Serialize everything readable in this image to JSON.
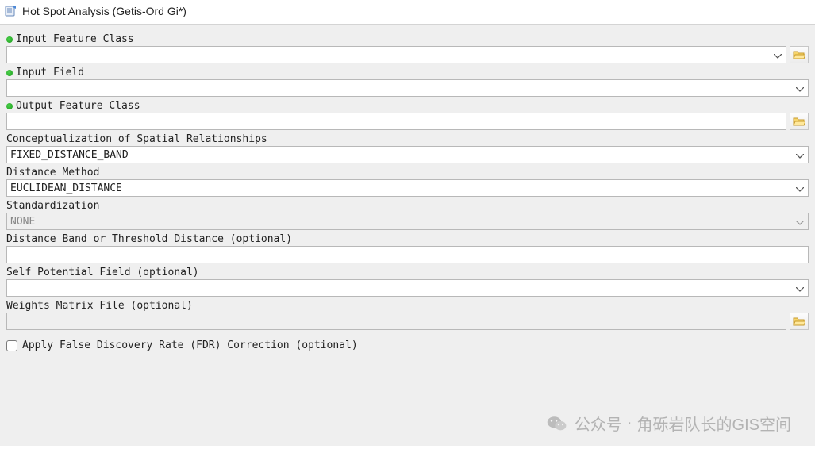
{
  "window": {
    "title": "Hot Spot Analysis (Getis-Ord Gi*)"
  },
  "params": {
    "input_feature_class": {
      "label": "Input Feature Class",
      "value": "",
      "required": true
    },
    "input_field": {
      "label": "Input Field",
      "value": "",
      "required": true
    },
    "output_feature_class": {
      "label": "Output Feature Class",
      "value": "",
      "required": true
    },
    "conceptualization": {
      "label": "Conceptualization of Spatial Relationships",
      "value": "FIXED_DISTANCE_BAND"
    },
    "distance_method": {
      "label": "Distance Method",
      "value": "EUCLIDEAN_DISTANCE"
    },
    "standardization": {
      "label": "Standardization",
      "value": "NONE"
    },
    "distance_band": {
      "label": "Distance Band or Threshold Distance (optional)",
      "value": ""
    },
    "self_potential_field": {
      "label": "Self Potential Field (optional)",
      "value": ""
    },
    "weights_matrix_file": {
      "label": "Weights Matrix File (optional)",
      "value": ""
    },
    "apply_fdr": {
      "label": "Apply False Discovery Rate (FDR) Correction (optional)",
      "checked": false
    }
  },
  "watermark": {
    "prefix": "公众号",
    "separator": "·",
    "name": "角砾岩队长的GIS空间"
  }
}
